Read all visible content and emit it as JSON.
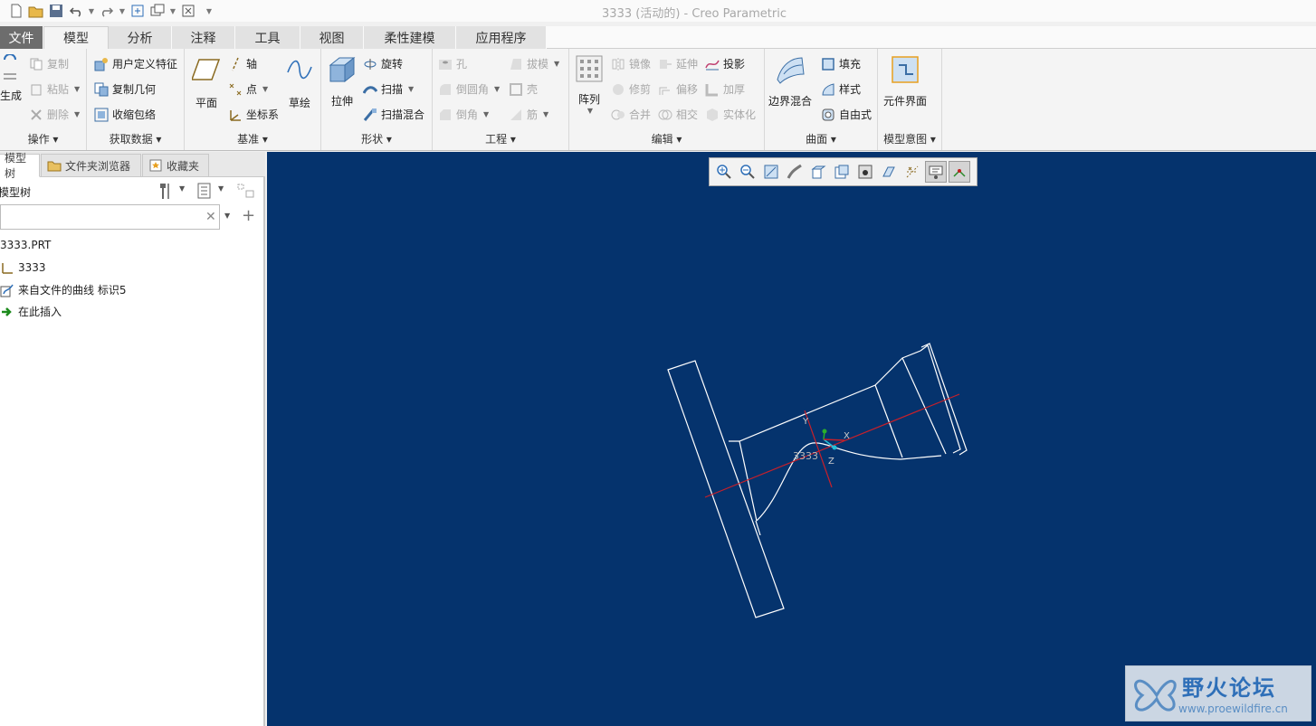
{
  "window": {
    "title": "3333 (活动的) - Creo Parametric"
  },
  "quick_access": [
    "new-icon",
    "open-icon",
    "save-icon",
    "undo-icon",
    "redo-icon",
    "regenerate-icon",
    "switch-window-icon",
    "close-window-icon",
    "customize-icon"
  ],
  "tabs": [
    {
      "label": "文件",
      "active": false,
      "file": true
    },
    {
      "label": "模型",
      "active": true
    },
    {
      "label": "分析",
      "active": false
    },
    {
      "label": "注释",
      "active": false
    },
    {
      "label": "工具",
      "active": false
    },
    {
      "label": "视图",
      "active": false
    },
    {
      "label": "柔性建模",
      "active": false
    },
    {
      "label": "应用程序",
      "active": false
    }
  ],
  "ribbon": {
    "ops": {
      "regen": "生成",
      "copy": "复制",
      "paste": "粘贴",
      "delete": "删除",
      "label": "操作"
    },
    "getdata": {
      "udf": "用户定义特征",
      "copygeom": "复制几何",
      "shrinkwrap": "收缩包络",
      "label": "获取数据"
    },
    "datum": {
      "plane": "平面",
      "axis": "轴",
      "point": "点",
      "csys": "坐标系",
      "sketch": "草绘",
      "label": "基准"
    },
    "shapes": {
      "extrude": "拉伸",
      "revolve": "旋转",
      "sweep": "扫描",
      "swept_blend": "扫描混合",
      "label": "形状"
    },
    "eng": {
      "hole": "孔",
      "round": "倒圆角",
      "chamfer": "倒角",
      "draft": "拔模",
      "shell": "壳",
      "rib": "筋",
      "label": "工程"
    },
    "edit": {
      "pattern": "阵列",
      "mirror": "镜像",
      "trim": "修剪",
      "merge": "合并",
      "extend": "延伸",
      "offset": "偏移",
      "intersect": "相交",
      "project": "投影",
      "thicken": "加厚",
      "solidify": "实体化",
      "label": "编辑"
    },
    "surfaces": {
      "boundary": "边界混合",
      "fill": "填充",
      "style": "样式",
      "freestyle": "自由式",
      "label": "曲面"
    },
    "intent": {
      "component_interface": "元件界面",
      "label": "模型意图"
    }
  },
  "panel": {
    "tabs": [
      "模型树",
      "文件夹浏览器",
      "收藏夹"
    ],
    "tree_title": "模型树",
    "search_value": "",
    "items": [
      "3333.PRT",
      "3333",
      "来自文件的曲线 标识5",
      "在此插入"
    ]
  },
  "viewport": {
    "background": "#05336d",
    "csys_label": "3333",
    "axis_x": "X",
    "axis_y": "Y",
    "axis_z": "Z",
    "toolbar": [
      "zoom-in-icon",
      "zoom-out-icon",
      "refit-icon",
      "reorient-icon",
      "saved-views-icon",
      "display-style-icon",
      "view-manager-icon",
      "perspective-icon",
      "datum-display-icon",
      "spin-center-icon",
      "annotation-display-icon"
    ]
  },
  "watermark": {
    "title": "野火论坛",
    "url": "www.proewildfire.cn"
  },
  "colors": {
    "accent_blue": "#1e6fc2",
    "geometry": "#ffffff",
    "datum_red": "#c8202a"
  }
}
